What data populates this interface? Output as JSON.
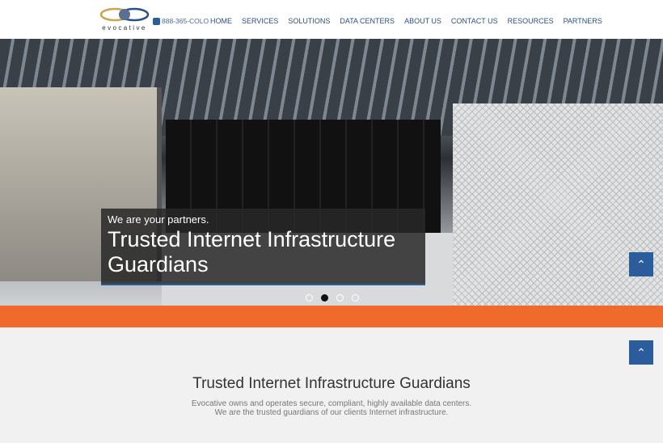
{
  "header": {
    "logo_text": "evocative",
    "phone": "888-365-COLO",
    "nav": [
      "HOME",
      "SERVICES",
      "SOLUTIONS",
      "DATA CENTERS",
      "ABOUT US",
      "CONTACT US",
      "RESOURCES",
      "PARTNERS"
    ]
  },
  "hero": {
    "subtitle": "We are your partners.",
    "title": "Trusted Internet Infrastructure Guardians",
    "slides": 4,
    "active_slide": 2
  },
  "main": {
    "title": "Trusted Internet Infrastructure Guardians",
    "desc_line1": "Evocative owns and operates secure, compliant, highly available data centers.",
    "desc_line2": "We are the trusted guardians of our clients Internet infrastructure."
  },
  "colors": {
    "accent": "#ef6a2b",
    "brand": "#2b5c9c"
  },
  "icons": {
    "phone": "phone-icon",
    "back_to_top": "chevron-up-icon"
  }
}
